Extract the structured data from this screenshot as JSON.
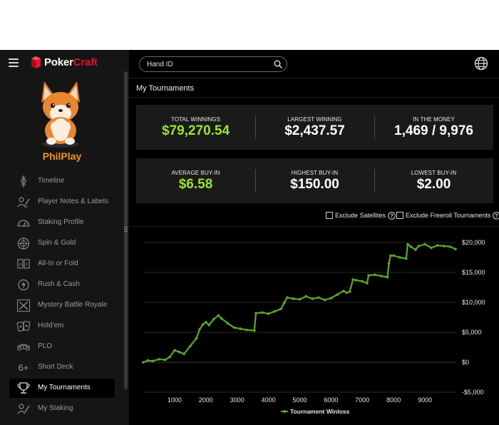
{
  "app": {
    "brand_left": "Poker",
    "brand_right": "Craft",
    "user": "PhilPlay"
  },
  "colors": {
    "accent_green": "#9ae534",
    "brand_red": "#e8102e",
    "user_orange": "#f2951a",
    "line_green": "#5ba829"
  },
  "sidebar": {
    "items": [
      {
        "label": "Timeline",
        "icon": "timeline-icon",
        "active": false
      },
      {
        "label": "Player Notes & Labels",
        "icon": "player-notes-icon",
        "active": false
      },
      {
        "label": "Staking Profile",
        "icon": "gauge-icon",
        "active": false
      },
      {
        "label": "Spin & Gold",
        "icon": "spin-icon",
        "active": false
      },
      {
        "label": "All-In or Fold",
        "icon": "cards-icon",
        "active": false
      },
      {
        "label": "Rush & Cash",
        "icon": "rush-icon",
        "active": false
      },
      {
        "label": "Mystery Battle Royale",
        "icon": "crossed-swords-icon",
        "active": false
      },
      {
        "label": "Hold'em",
        "icon": "holdem-cards-icon",
        "active": false
      },
      {
        "label": "PLO",
        "icon": "plo-cards-icon",
        "active": false
      },
      {
        "label": "Short Deck",
        "icon": "six-plus-icon",
        "active": false,
        "glyph": "6+"
      },
      {
        "label": "My Tournaments",
        "icon": "trophy-icon",
        "active": true
      },
      {
        "label": "My Staking",
        "icon": "staking-icon",
        "active": false
      }
    ]
  },
  "search": {
    "placeholder": "Hand ID",
    "value": ""
  },
  "page": {
    "title": "My Tournaments"
  },
  "stats_top": [
    {
      "label": "TOTAL WINNINGS",
      "value": "$79,270.54",
      "highlight": true
    },
    {
      "label": "LARGEST WINNING",
      "value": "$2,437.57",
      "highlight": false
    },
    {
      "label": "IN THE MONEY",
      "value": "1,469 / 9,976",
      "highlight": false
    }
  ],
  "stats_bottom": [
    {
      "label": "AVERAGE BUY-IN",
      "value": "$6.58",
      "highlight": true
    },
    {
      "label": "HIGHEST BUY-IN",
      "value": "$150.00",
      "highlight": false
    },
    {
      "label": "LOWEST BUY-IN",
      "value": "$2.00",
      "highlight": false
    }
  ],
  "filters": {
    "exclude_satellites": {
      "label": "Exclude Satellites",
      "checked": false
    },
    "exclude_freeroll": {
      "label": "Exclude Freeroll Tournaments",
      "checked": false
    }
  },
  "chart_data": {
    "type": "line",
    "title": "",
    "xlabel": "",
    "ylabel": "",
    "xlim": [
      0,
      10000
    ],
    "ylim": [
      -5000,
      20000
    ],
    "x_ticks": [
      1000,
      2000,
      3000,
      4000,
      5000,
      6000,
      7000,
      8000,
      9000
    ],
    "y_ticks": [
      -5000,
      0,
      5000,
      10000,
      15000,
      20000
    ],
    "y_tick_labels": [
      "-$5,000",
      "$0",
      "$5,000",
      "$10,000",
      "$15,000",
      "$20,000"
    ],
    "y_axis_side": "right",
    "grid": "horizontal",
    "legend": "bottom",
    "series": [
      {
        "name": "Tournament Winloss",
        "x": [
          0,
          150,
          300,
          500,
          700,
          850,
          1000,
          1150,
          1300,
          1500,
          1700,
          1800,
          1900,
          2000,
          2100,
          2250,
          2400,
          2500,
          2700,
          2900,
          3100,
          3300,
          3550,
          3600,
          3800,
          4000,
          4200,
          4400,
          4500,
          4600,
          4800,
          5000,
          5200,
          5400,
          5600,
          5800,
          6000,
          6200,
          6400,
          6500,
          6600,
          6700,
          6800,
          7000,
          7150,
          7200,
          7400,
          7600,
          7800,
          7850,
          7900,
          8000,
          8200,
          8400,
          8450,
          8550,
          8700,
          8800,
          9000,
          9200,
          9400,
          9600,
          9800,
          9976
        ],
        "y": [
          0,
          300,
          200,
          500,
          400,
          900,
          2000,
          1700,
          1400,
          2700,
          4000,
          5500,
          6300,
          6700,
          6200,
          7200,
          7800,
          7300,
          6500,
          5800,
          5600,
          5400,
          5300,
          8200,
          8300,
          8100,
          8500,
          8900,
          9900,
          10800,
          10600,
          10500,
          11000,
          10600,
          10800,
          10400,
          10700,
          11300,
          11900,
          11600,
          11800,
          13800,
          13700,
          13500,
          13200,
          14500,
          14600,
          14400,
          14200,
          16500,
          17800,
          17800,
          17500,
          17300,
          19700,
          19300,
          18800,
          19400,
          19700,
          19100,
          19500,
          19400,
          19300,
          18900
        ]
      }
    ]
  }
}
